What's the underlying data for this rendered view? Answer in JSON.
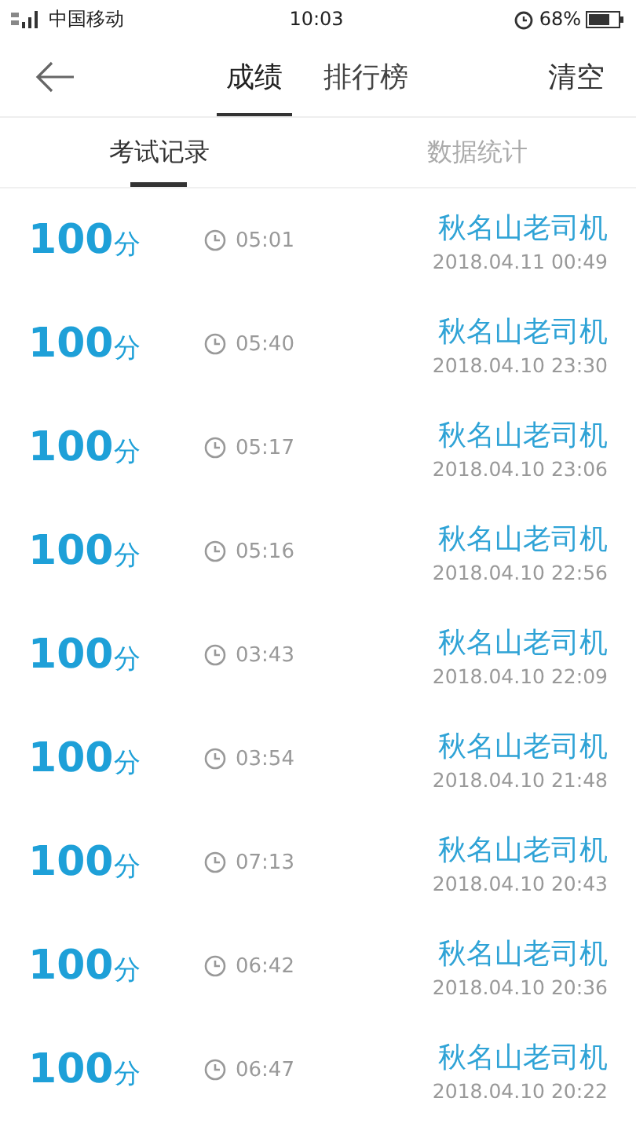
{
  "status_bar": {
    "carrier": "中国移动",
    "time": "10:03",
    "battery": "68%"
  },
  "header": {
    "tabs": [
      {
        "label": "成绩",
        "selected": true
      },
      {
        "label": "排行榜",
        "selected": false
      }
    ],
    "action": "清空"
  },
  "sub_tabs": [
    {
      "label": "考试记录",
      "selected": true
    },
    {
      "label": "数据统计",
      "selected": false
    }
  ],
  "records": [
    {
      "score": "100",
      "unit": "分",
      "duration": "05:01",
      "name": "秋名山老司机",
      "date": "2018.04.11  00:49"
    },
    {
      "score": "100",
      "unit": "分",
      "duration": "05:40",
      "name": "秋名山老司机",
      "date": "2018.04.10  23:30"
    },
    {
      "score": "100",
      "unit": "分",
      "duration": "05:17",
      "name": "秋名山老司机",
      "date": "2018.04.10  23:06"
    },
    {
      "score": "100",
      "unit": "分",
      "duration": "05:16",
      "name": "秋名山老司机",
      "date": "2018.04.10  22:56"
    },
    {
      "score": "100",
      "unit": "分",
      "duration": "03:43",
      "name": "秋名山老司机",
      "date": "2018.04.10  22:09"
    },
    {
      "score": "100",
      "unit": "分",
      "duration": "03:54",
      "name": "秋名山老司机",
      "date": "2018.04.10  21:48"
    },
    {
      "score": "100",
      "unit": "分",
      "duration": "07:13",
      "name": "秋名山老司机",
      "date": "2018.04.10  20:43"
    },
    {
      "score": "100",
      "unit": "分",
      "duration": "06:42",
      "name": "秋名山老司机",
      "date": "2018.04.10  20:36"
    },
    {
      "score": "100",
      "unit": "分",
      "duration": "06:47",
      "name": "秋名山老司机",
      "date": "2018.04.10  20:22"
    }
  ]
}
